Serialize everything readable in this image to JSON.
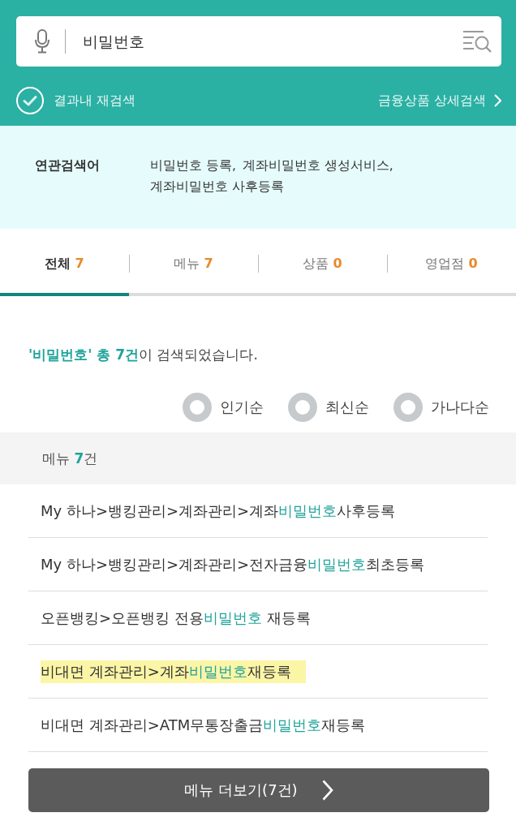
{
  "search": {
    "value": "비밀번호"
  },
  "refine": {
    "label": "결과내 재검색",
    "checked": false
  },
  "detail_link": {
    "label": "금융상품 상세검색"
  },
  "related": {
    "label": "연관검색어",
    "terms": [
      "비밀번호 등록,",
      "계좌비밀번호 생성서비스,",
      "계좌비밀번호 사후등록"
    ]
  },
  "tabs": [
    {
      "label": "전체",
      "count": "7",
      "selected": true
    },
    {
      "label": "메뉴",
      "count": "7",
      "selected": false
    },
    {
      "label": "상품",
      "count": "0",
      "selected": false
    },
    {
      "label": "영업점",
      "count": "0",
      "selected": false
    }
  ],
  "summary": {
    "parts": [
      {
        "text": "'비밀번호' 총 7건",
        "emphasis": true
      },
      {
        "text": "이 검색되었습니다.",
        "emphasis": false
      }
    ]
  },
  "sort_options": [
    {
      "label": "인기순",
      "selected": false
    },
    {
      "label": "최신순",
      "selected": false
    },
    {
      "label": "가나다순",
      "selected": false
    }
  ],
  "section": {
    "parts": [
      {
        "text": "메뉴 ",
        "emphasis": false
      },
      {
        "text": "7",
        "emphasis": true
      },
      {
        "text": "건",
        "emphasis": false
      }
    ]
  },
  "results": [
    {
      "highlighted": false,
      "parts": [
        {
          "text": "My 하나>뱅킹관리>계좌관리>계좌",
          "emphasis": false
        },
        {
          "text": "비밀번호",
          "emphasis": true
        },
        {
          "text": "사후등록",
          "emphasis": false
        }
      ]
    },
    {
      "highlighted": false,
      "parts": [
        {
          "text": "My 하나>뱅킹관리>계좌관리>전자금융",
          "emphasis": false
        },
        {
          "text": "비밀번호",
          "emphasis": true
        },
        {
          "text": "최초등록",
          "emphasis": false
        }
      ]
    },
    {
      "highlighted": false,
      "parts": [
        {
          "text": "오픈뱅킹>오픈뱅킹 전용",
          "emphasis": false
        },
        {
          "text": "비밀번호",
          "emphasis": true
        },
        {
          "text": " 재등록",
          "emphasis": false
        }
      ]
    },
    {
      "highlighted": true,
      "parts": [
        {
          "text": "비대면 계좌관리>계좌",
          "emphasis": false
        },
        {
          "text": "비밀번호",
          "emphasis": true
        },
        {
          "text": "재등록",
          "emphasis": false
        }
      ]
    },
    {
      "highlighted": false,
      "parts": [
        {
          "text": "비대면 계좌관리>ATM무통장출금",
          "emphasis": false
        },
        {
          "text": "비밀번호",
          "emphasis": true
        },
        {
          "text": "재등록",
          "emphasis": false
        }
      ]
    }
  ],
  "more_button": {
    "label": "메뉴 더보기(7건)"
  }
}
